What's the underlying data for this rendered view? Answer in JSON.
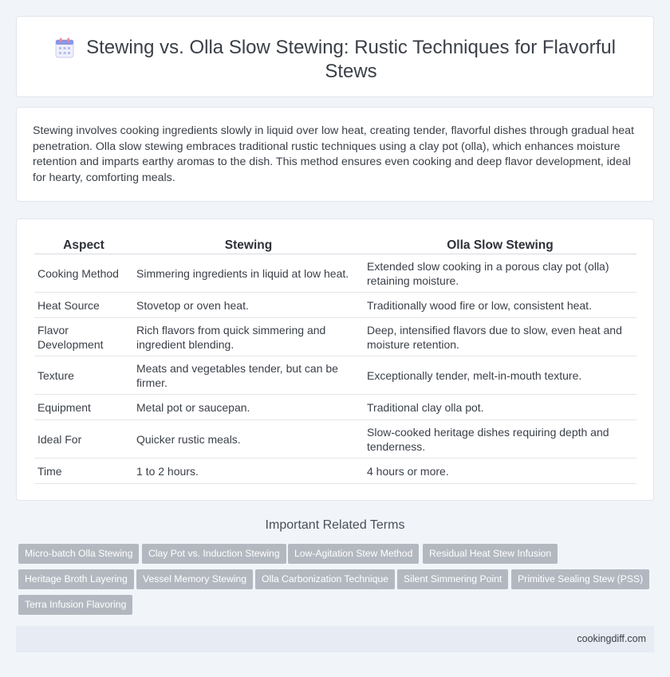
{
  "header": {
    "title": "Stewing vs. Olla Slow Stewing: Rustic Techniques for Flavorful Stews",
    "icon": "calendar-icon"
  },
  "intro": {
    "text": "Stewing involves cooking ingredients slowly in liquid over low heat, creating tender, flavorful dishes through gradual heat penetration. Olla slow stewing embraces traditional rustic techniques using a clay pot (olla), which enhances moisture retention and imparts earthy aromas to the dish. This method ensures even cooking and deep flavor development, ideal for hearty, comforting meals."
  },
  "table": {
    "headers": [
      "Aspect",
      "Stewing",
      "Olla Slow Stewing"
    ],
    "rows": [
      [
        "Cooking Method",
        "Simmering ingredients in liquid at low heat.",
        "Extended slow cooking in a porous clay pot (olla) retaining moisture."
      ],
      [
        "Heat Source",
        "Stovetop or oven heat.",
        "Traditionally wood fire or low, consistent heat."
      ],
      [
        "Flavor Development",
        "Rich flavors from quick simmering and ingredient blending.",
        "Deep, intensified flavors due to slow, even heat and moisture retention."
      ],
      [
        "Texture",
        "Meats and vegetables tender, but can be firmer.",
        "Exceptionally tender, melt-in-mouth texture."
      ],
      [
        "Equipment",
        "Metal pot or saucepan.",
        "Traditional clay olla pot."
      ],
      [
        "Ideal For",
        "Quicker rustic meals.",
        "Slow-cooked heritage dishes requiring depth and tenderness."
      ],
      [
        "Time",
        "1 to 2 hours.",
        "4 hours or more."
      ]
    ]
  },
  "related": {
    "title": "Important Related Terms",
    "tags": [
      "Micro-batch Olla Stewing",
      "Clay Pot vs. Induction Stewing",
      "Low-Agitation Stew Method",
      "Residual Heat Stew Infusion",
      "Heritage Broth Layering",
      "Vessel Memory Stewing",
      "Olla Carbonization Technique",
      "Silent Simmering Point",
      "Primitive Sealing Stew (PSS)",
      "Terra Infusion Flavoring"
    ]
  },
  "footer": {
    "site": "cookingdiff.com"
  }
}
